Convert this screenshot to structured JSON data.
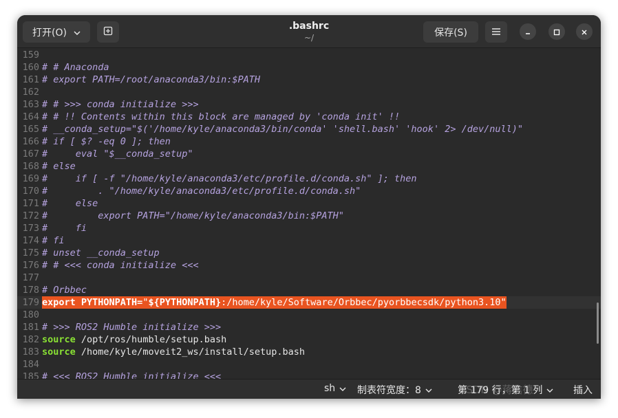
{
  "header": {
    "open_label": "打开(O)",
    "save_label": "保存(S)",
    "title": ".bashrc",
    "subtitle": "~/"
  },
  "editor": {
    "current_line": 179,
    "lines": [
      {
        "n": "159",
        "segs": []
      },
      {
        "n": "160",
        "segs": [
          {
            "t": "# # Anaconda",
            "c": "comment"
          }
        ]
      },
      {
        "n": "161",
        "segs": [
          {
            "t": "# export PATH=/root/anaconda3/bin:$PATH",
            "c": "comment"
          }
        ]
      },
      {
        "n": "162",
        "segs": []
      },
      {
        "n": "163",
        "segs": [
          {
            "t": "# # >>> conda initialize >>>",
            "c": "comment"
          }
        ]
      },
      {
        "n": "164",
        "segs": [
          {
            "t": "# # !! Contents within this block are managed by 'conda init' !!",
            "c": "comment"
          }
        ]
      },
      {
        "n": "165",
        "segs": [
          {
            "t": "# __conda_setup=\"$('/home/kyle/anaconda3/bin/conda' 'shell.bash' 'hook' 2> /dev/null)\"",
            "c": "comment"
          }
        ]
      },
      {
        "n": "166",
        "segs": [
          {
            "t": "# if [ $? -eq 0 ]; then",
            "c": "comment"
          }
        ]
      },
      {
        "n": "167",
        "segs": [
          {
            "t": "#     eval \"$__conda_setup\"",
            "c": "comment"
          }
        ]
      },
      {
        "n": "168",
        "segs": [
          {
            "t": "# else",
            "c": "comment"
          }
        ]
      },
      {
        "n": "169",
        "segs": [
          {
            "t": "#     if [ -f \"/home/kyle/anaconda3/etc/profile.d/conda.sh\" ]; then",
            "c": "comment"
          }
        ]
      },
      {
        "n": "170",
        "segs": [
          {
            "t": "#         . \"/home/kyle/anaconda3/etc/profile.d/conda.sh\"",
            "c": "comment"
          }
        ]
      },
      {
        "n": "171",
        "segs": [
          {
            "t": "#     else",
            "c": "comment"
          }
        ]
      },
      {
        "n": "172",
        "segs": [
          {
            "t": "#         export PATH=\"/home/kyle/anaconda3/bin:$PATH\"",
            "c": "comment"
          }
        ]
      },
      {
        "n": "173",
        "segs": [
          {
            "t": "#     fi",
            "c": "comment"
          }
        ]
      },
      {
        "n": "174",
        "segs": [
          {
            "t": "# fi",
            "c": "comment"
          }
        ]
      },
      {
        "n": "175",
        "segs": [
          {
            "t": "# unset __conda_setup",
            "c": "comment"
          }
        ]
      },
      {
        "n": "176",
        "segs": [
          {
            "t": "# # <<< conda initialize <<<",
            "c": "comment"
          }
        ]
      },
      {
        "n": "177",
        "segs": []
      },
      {
        "n": "178",
        "segs": [
          {
            "t": "# Orbbec",
            "c": "comment"
          }
        ]
      },
      {
        "n": "179",
        "selected": true,
        "segs": [
          {
            "t": "export",
            "c": "hl-kw"
          },
          {
            "t": " PYTHONPATH=",
            "c": "hl-kw"
          },
          {
            "t": "\"",
            "c": "hl-str"
          },
          {
            "t": "${PYTHONPATH}",
            "c": "hl-var"
          },
          {
            "t": ":/home/kyle/Software/Orbbec/pyorbbecsdk/python3.10\"",
            "c": "hl-str"
          }
        ]
      },
      {
        "n": "180",
        "segs": []
      },
      {
        "n": "181",
        "segs": [
          {
            "t": "# >>> ROS2 Humble initialize >>>",
            "c": "comment"
          }
        ]
      },
      {
        "n": "182",
        "segs": [
          {
            "t": "source",
            "c": "kw"
          },
          {
            "t": " /opt/ros/humble/setup.bash",
            "c": "plain"
          }
        ]
      },
      {
        "n": "183",
        "segs": [
          {
            "t": "source",
            "c": "kw"
          },
          {
            "t": " /home/kyle/moveit2_ws/install/setup.bash",
            "c": "plain"
          }
        ]
      },
      {
        "n": "184",
        "segs": []
      },
      {
        "n": "185",
        "segs": [
          {
            "t": "# <<< ROS2 Humble initialize <<<",
            "c": "comment"
          }
        ]
      }
    ]
  },
  "status": {
    "language": "sh",
    "tab_width": "制表符宽度：8",
    "position": "第 179 行，第 1 列",
    "mode": "插入",
    "watermark": "CSDN @蒋信德"
  },
  "colors": {
    "selection": "#e95420",
    "comment": "#b6a3e0",
    "keyword": "#8ae234",
    "background": "#2a2a2a"
  }
}
